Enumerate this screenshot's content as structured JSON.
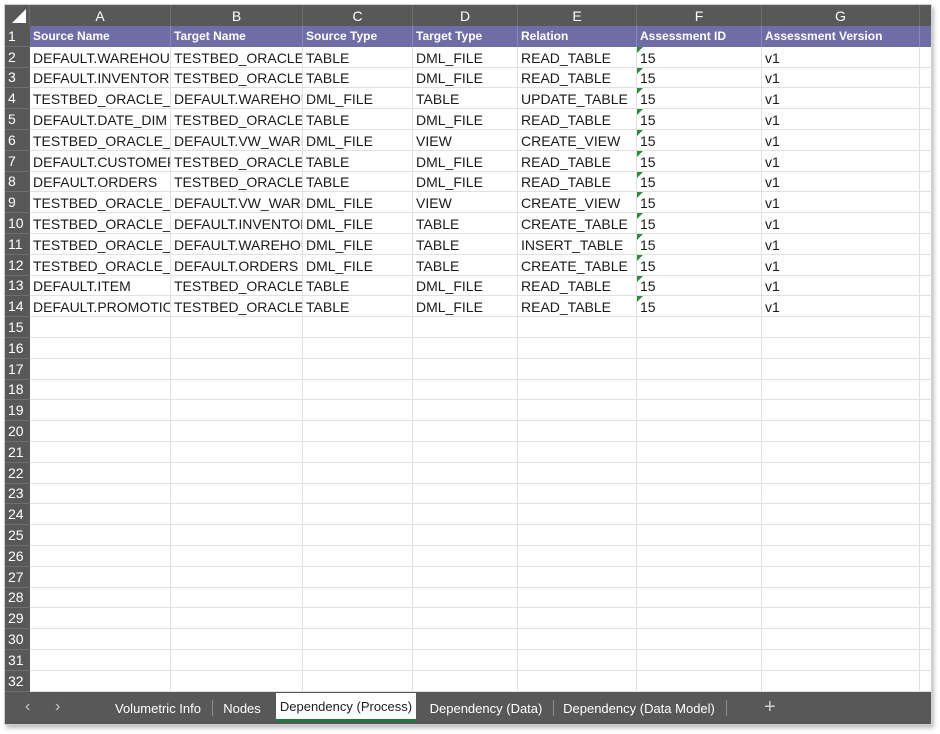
{
  "columns": [
    "A",
    "B",
    "C",
    "D",
    "E",
    "F",
    "G"
  ],
  "headers": [
    "Source Name",
    "Target Name",
    "Source Type",
    "Target Type",
    "Relation",
    "Assessment ID",
    "Assessment Version"
  ],
  "rows": [
    [
      "DEFAULT.WAREHOUSI",
      "TESTBED_ORACLE_D",
      "TABLE",
      "DML_FILE",
      "READ_TABLE",
      "15",
      "v1"
    ],
    [
      "DEFAULT.INVENTORY",
      "TESTBED_ORACLE_D",
      "TABLE",
      "DML_FILE",
      "READ_TABLE",
      "15",
      "v1"
    ],
    [
      "TESTBED_ORACLE_DM",
      "DEFAULT.WAREHOU",
      "DML_FILE",
      "TABLE",
      "UPDATE_TABLE",
      "15",
      "v1"
    ],
    [
      "DEFAULT.DATE_DIM",
      "TESTBED_ORACLE_D",
      "TABLE",
      "DML_FILE",
      "READ_TABLE",
      "15",
      "v1"
    ],
    [
      "TESTBED_ORACLE_DM",
      "DEFAULT.VW_WAREI",
      "DML_FILE",
      "VIEW",
      "CREATE_VIEW",
      "15",
      "v1"
    ],
    [
      "DEFAULT.CUSTOMER",
      "TESTBED_ORACLE_D",
      "TABLE",
      "DML_FILE",
      "READ_TABLE",
      "15",
      "v1"
    ],
    [
      "DEFAULT.ORDERS",
      "TESTBED_ORACLE_D",
      "TABLE",
      "DML_FILE",
      "READ_TABLE",
      "15",
      "v1"
    ],
    [
      "TESTBED_ORACLE_DM",
      "DEFAULT.VW_WAREI",
      "DML_FILE",
      "VIEW",
      "CREATE_VIEW",
      "15",
      "v1"
    ],
    [
      "TESTBED_ORACLE_DM",
      "DEFAULT.INVENTORY",
      "DML_FILE",
      "TABLE",
      "CREATE_TABLE",
      "15",
      "v1"
    ],
    [
      "TESTBED_ORACLE_DM",
      "DEFAULT.WAREHOU",
      "DML_FILE",
      "TABLE",
      "INSERT_TABLE",
      "15",
      "v1"
    ],
    [
      "TESTBED_ORACLE_DM",
      "DEFAULT.ORDERS",
      "DML_FILE",
      "TABLE",
      "CREATE_TABLE",
      "15",
      "v1"
    ],
    [
      "DEFAULT.ITEM",
      "TESTBED_ORACLE_D",
      "TABLE",
      "DML_FILE",
      "READ_TABLE",
      "15",
      "v1"
    ],
    [
      "DEFAULT.PROMOTION",
      "TESTBED_ORACLE_D",
      "TABLE",
      "DML_FILE",
      "READ_TABLE",
      "15",
      "v1"
    ]
  ],
  "row_numbers": [
    "1",
    "2",
    "3",
    "4",
    "5",
    "6",
    "7",
    "8",
    "9",
    "10",
    "11",
    "12",
    "13",
    "14",
    "15",
    "16",
    "17",
    "18",
    "19",
    "20",
    "21",
    "22",
    "23",
    "24",
    "25",
    "26",
    "27",
    "28",
    "29",
    "30",
    "31",
    "32"
  ],
  "tabs": [
    {
      "label": "Volumetric Info",
      "active": false
    },
    {
      "label": "Nodes",
      "active": false
    },
    {
      "label": "Dependency (Process)",
      "active": true
    },
    {
      "label": "Dependency (Data)",
      "active": false
    },
    {
      "label": "Dependency (Data Model)",
      "active": false
    }
  ],
  "nav": {
    "prev_icon": "‹",
    "next_icon": "›",
    "add_icon": "+"
  },
  "colors": {
    "header_fill": "#6f6da6",
    "chrome": "#585858",
    "active_tab_underline": "#1d7a3b",
    "number_text_flag": "#2f8a3a"
  }
}
